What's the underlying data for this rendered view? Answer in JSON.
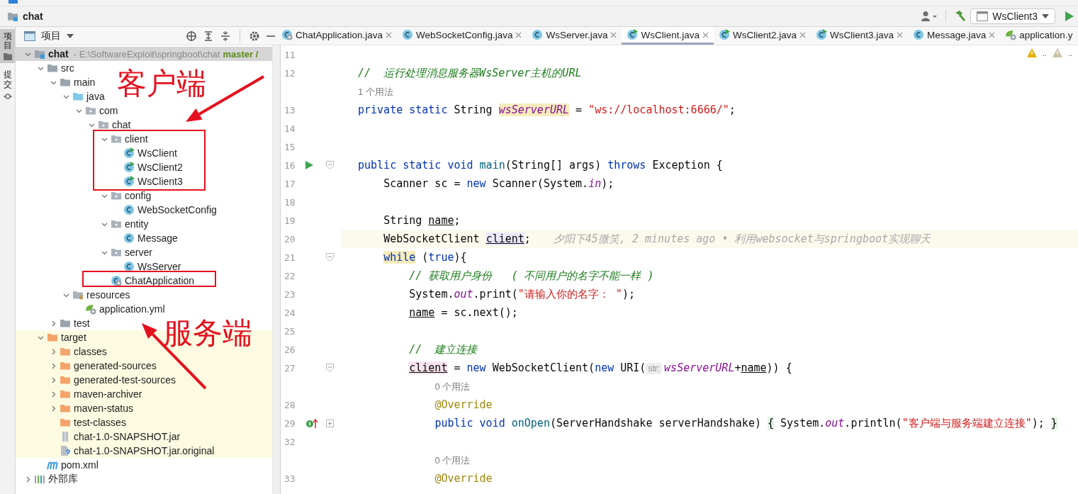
{
  "navbar": {
    "project": "chat",
    "run_config": "WsClient3"
  },
  "tool_stripe": [
    {
      "label": "项目",
      "selected": true
    },
    {
      "label": "提交",
      "selected": false
    }
  ],
  "project_panel": {
    "title": "项目",
    "tree": [
      {
        "label": "chat",
        "kind": "module",
        "expanded": true,
        "selected": true,
        "path": "- E:\\SoftwareExploit\\springboot\\chat",
        "branch": "master /",
        "children": [
          {
            "label": "src",
            "kind": "folder",
            "expanded": true,
            "selected": false,
            "children": [
              {
                "label": "main",
                "kind": "folder",
                "expanded": true,
                "selected": false,
                "children": [
                  {
                    "label": "java",
                    "kind": "source-root",
                    "expanded": true,
                    "selected": false,
                    "children": [
                      {
                        "label": "com",
                        "kind": "package",
                        "expanded": true,
                        "selected": false,
                        "children": [
                          {
                            "label": "chat",
                            "kind": "package",
                            "expanded": true,
                            "selected": false,
                            "children": [
                              {
                                "label": "client",
                                "kind": "package",
                                "expanded": true,
                                "selected": false,
                                "children": [
                                  {
                                    "label": "WsClient",
                                    "kind": "runnable-class",
                                    "selected": false
                                  },
                                  {
                                    "label": "WsClient2",
                                    "kind": "runnable-class",
                                    "selected": false
                                  },
                                  {
                                    "label": "WsClient3",
                                    "kind": "runnable-class",
                                    "selected": false
                                  }
                                ]
                              },
                              {
                                "label": "config",
                                "kind": "package",
                                "expanded": true,
                                "selected": false,
                                "children": [
                                  {
                                    "label": "WebSocketConfig",
                                    "kind": "class",
                                    "selected": false
                                  }
                                ]
                              },
                              {
                                "label": "entity",
                                "kind": "package",
                                "expanded": true,
                                "selected": false,
                                "children": [
                                  {
                                    "label": "Message",
                                    "kind": "class",
                                    "selected": false
                                  }
                                ]
                              },
                              {
                                "label": "server",
                                "kind": "package",
                                "expanded": true,
                                "selected": false,
                                "children": [
                                  {
                                    "label": "WsServer",
                                    "kind": "class",
                                    "selected": false
                                  }
                                ]
                              },
                              {
                                "label": "ChatApplication",
                                "kind": "spring-class",
                                "selected": false
                              }
                            ]
                          }
                        ]
                      }
                    ]
                  },
                  {
                    "label": "resources",
                    "kind": "resources-root",
                    "expanded": true,
                    "selected": false,
                    "children": [
                      {
                        "label": "application.yml",
                        "kind": "yml",
                        "selected": false
                      }
                    ]
                  }
                ]
              },
              {
                "label": "test",
                "kind": "folder",
                "expanded": false,
                "selected": false
              }
            ]
          },
          {
            "label": "target",
            "kind": "excluded-folder",
            "expanded": true,
            "excluded": true,
            "selected": false,
            "children": [
              {
                "label": "classes",
                "kind": "excluded-folder",
                "expanded": false,
                "selected": false
              },
              {
                "label": "generated-sources",
                "kind": "excluded-folder",
                "expanded": false,
                "selected": false
              },
              {
                "label": "generated-test-sources",
                "kind": "excluded-folder",
                "expanded": false,
                "selected": false
              },
              {
                "label": "maven-archiver",
                "kind": "excluded-folder",
                "expanded": false,
                "selected": false
              },
              {
                "label": "maven-status",
                "kind": "excluded-folder",
                "expanded": false,
                "selected": false
              },
              {
                "label": "test-classes",
                "kind": "excluded-folder",
                "selected": false
              },
              {
                "label": "chat-1.0-SNAPSHOT.jar",
                "kind": "jar",
                "selected": false
              },
              {
                "label": "chat-1.0-SNAPSHOT.jar.original",
                "kind": "unknown-file",
                "selected": false
              }
            ]
          },
          {
            "label": "pom.xml",
            "kind": "maven",
            "selected": false
          }
        ]
      },
      {
        "label": "外部库",
        "kind": "library",
        "expanded": false,
        "selected": false
      }
    ]
  },
  "tabs": [
    {
      "label": "ChatApplication.java",
      "kind": "spring-class",
      "selected": false
    },
    {
      "label": "WebSocketConfig.java",
      "kind": "class",
      "selected": false
    },
    {
      "label": "WsServer.java",
      "kind": "class",
      "selected": false
    },
    {
      "label": "WsClient.java",
      "kind": "runnable-class",
      "selected": true
    },
    {
      "label": "WsClient2.java",
      "kind": "runnable-class",
      "selected": false
    },
    {
      "label": "WsClient3.java",
      "kind": "runnable-class",
      "selected": false
    },
    {
      "label": "Message.java",
      "kind": "class",
      "selected": false
    },
    {
      "label": "application.y",
      "kind": "yml",
      "selected": false
    }
  ],
  "inspections": [
    {
      "kind": "warning",
      "text": ".."
    },
    {
      "kind": "weak-warning",
      "text": ".."
    }
  ],
  "code": [
    {
      "kind": "code",
      "no": "11"
    },
    {
      "kind": "code",
      "no": "12",
      "tokens": [
        {
          "t": "//  运行处理消息服务器WsServer主机的URL",
          "kind": "comment"
        }
      ]
    },
    {
      "kind": "hint",
      "text": "1 个用法"
    },
    {
      "kind": "code",
      "no": "13",
      "tokens": [
        {
          "t": "private static ",
          "kind": "keyword"
        },
        {
          "t": "String ",
          "kind": "plain"
        },
        {
          "t": "wsServerURL",
          "kind": "field-match"
        },
        {
          "t": " = ",
          "kind": "plain"
        },
        {
          "t": "\"ws://localhost:6666/\"",
          "kind": "string"
        },
        {
          "t": ";",
          "kind": "plain"
        }
      ]
    },
    {
      "kind": "code",
      "no": "14"
    },
    {
      "kind": "code",
      "no": "15"
    },
    {
      "kind": "code",
      "no": "16",
      "run_marker": true,
      "folded": false,
      "tokens": [
        {
          "t": "public static void ",
          "kind": "keyword"
        },
        {
          "t": "main",
          "kind": "method"
        },
        {
          "t": "(String[] args) ",
          "kind": "plain"
        },
        {
          "t": "throws",
          "kind": "keyword"
        },
        {
          "t": " Exception {",
          "kind": "plain"
        }
      ]
    },
    {
      "kind": "code",
      "no": "17",
      "tokens": [
        {
          "t": "    Scanner sc = ",
          "kind": "plain"
        },
        {
          "t": "new",
          "kind": "keyword"
        },
        {
          "t": " Scanner(System.",
          "kind": "plain"
        },
        {
          "t": "in",
          "kind": "static"
        },
        {
          "t": ");",
          "kind": "plain"
        }
      ]
    },
    {
      "kind": "code",
      "no": "18"
    },
    {
      "kind": "code",
      "no": "19",
      "tokens": [
        {
          "t": "    String ",
          "kind": "plain"
        },
        {
          "t": "name",
          "kind": "variable"
        },
        {
          "t": ";",
          "kind": "plain"
        }
      ]
    },
    {
      "kind": "code",
      "no": "20",
      "current": true,
      "blame": "夕阳下45微笑, 2 minutes ago • 利用websocket与springboot实现聊天",
      "tokens": [
        {
          "t": "    WebSocketClient ",
          "kind": "plain"
        },
        {
          "t": "client",
          "kind": "variable-usage"
        },
        {
          "t": ";",
          "kind": "plain"
        }
      ]
    },
    {
      "kind": "code",
      "no": "21",
      "folded": false,
      "tokens": [
        {
          "t": "    while",
          "kind": "keyword-match"
        },
        {
          "t": " (",
          "kind": "plain"
        },
        {
          "t": "true",
          "kind": "keyword"
        },
        {
          "t": "){",
          "kind": "plain"
        }
      ]
    },
    {
      "kind": "code",
      "no": "22",
      "tokens": [
        {
          "t": "        // 获取用户身份   ( 不同用户的名字不能一样 )",
          "kind": "comment"
        }
      ]
    },
    {
      "kind": "code",
      "no": "23",
      "tokens": [
        {
          "t": "        System.",
          "kind": "plain"
        },
        {
          "t": "out",
          "kind": "static"
        },
        {
          "t": ".print(",
          "kind": "plain"
        },
        {
          "t": "\"请输入你的名字： \"",
          "kind": "string"
        },
        {
          "t": ");",
          "kind": "plain"
        }
      ]
    },
    {
      "kind": "code",
      "no": "24",
      "tokens": [
        {
          "t": "        name",
          "kind": "variable"
        },
        {
          "t": " = sc.next();",
          "kind": "plain"
        }
      ]
    },
    {
      "kind": "code",
      "no": "25"
    },
    {
      "kind": "code",
      "no": "26",
      "tokens": [
        {
          "t": "        //  建立连接",
          "kind": "comment"
        }
      ]
    },
    {
      "kind": "code",
      "no": "27",
      "folded": false,
      "tokens": [
        {
          "t": "        client",
          "kind": "variable-write"
        },
        {
          "t": " = ",
          "kind": "plain"
        },
        {
          "t": "new",
          "kind": "keyword"
        },
        {
          "t": " WebSocketClient(",
          "kind": "plain"
        },
        {
          "t": "new",
          "kind": "keyword"
        },
        {
          "t": " URI(",
          "kind": "plain"
        },
        {
          "t": "str:",
          "kind": "inlay"
        },
        {
          "t": "wsServerURL",
          "kind": "field"
        },
        {
          "t": "+",
          "kind": "plain"
        },
        {
          "t": "name",
          "kind": "variable"
        },
        {
          "t": ")) {",
          "kind": "plain"
        }
      ]
    },
    {
      "kind": "hint",
      "text": "            0 个用法"
    },
    {
      "kind": "code",
      "no": "28",
      "tokens": [
        {
          "t": "            @Override",
          "kind": "annotation"
        }
      ]
    },
    {
      "kind": "code",
      "no": "29",
      "implements_marker": true,
      "folded": true,
      "tokens": [
        {
          "t": "            public void ",
          "kind": "keyword"
        },
        {
          "t": "onOpen",
          "kind": "method"
        },
        {
          "t": "(ServerHandshake serverHandshake) ",
          "kind": "plain"
        },
        {
          "t": "{",
          "kind": "brace-match"
        },
        {
          "t": " System.",
          "kind": "plain"
        },
        {
          "t": "out",
          "kind": "static"
        },
        {
          "t": ".println(",
          "kind": "plain"
        },
        {
          "t": "\"客户端与服务端建立连接\"",
          "kind": "string"
        },
        {
          "t": "); ",
          "kind": "plain"
        },
        {
          "t": "}",
          "kind": "brace-match"
        }
      ]
    },
    {
      "kind": "code",
      "no": "32"
    },
    {
      "kind": "hint",
      "text": "            0 个用法"
    },
    {
      "kind": "code",
      "no": "33",
      "tokens": [
        {
          "t": "            @Override",
          "kind": "annotation"
        }
      ]
    }
  ],
  "annotations": [
    "客户端",
    "服务端"
  ]
}
